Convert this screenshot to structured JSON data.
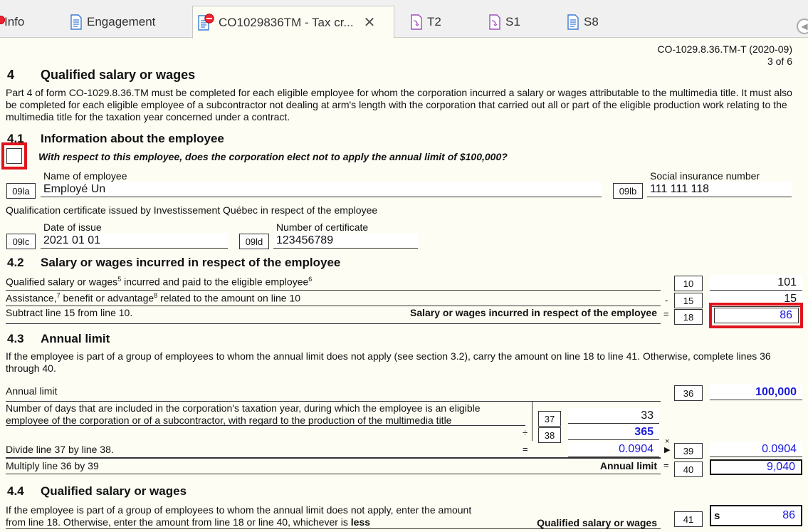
{
  "tabs": [
    {
      "label": "Info"
    },
    {
      "label": "Engagement"
    },
    {
      "label": "CO1029836TM - Tax cr..."
    },
    {
      "label": "T2"
    },
    {
      "label": "S1"
    },
    {
      "label": "S8"
    }
  ],
  "form": {
    "form_id": "CO-1029.8.36.TM-T (2020-09)",
    "page": "3 of 6",
    "section4": {
      "number": "4",
      "title": "Qualified salary or wages",
      "description": "Part 4 of form CO-1029.8.36.TM must be completed for each eligible employee for whom the corporation incurred a salary or wages attributable to the multimedia title. It must also be completed for each eligible employee of a subcontractor not dealing at arm's length with the corporation that carried out all or part of the eligible production work relating to the multimedia title for the taxation year concerned under a contract."
    },
    "s41": {
      "number": "4.1",
      "title": "Information about the employee",
      "election_question": "With respect to this employee, does the corporation elect not to apply the annual limit of $100,000?",
      "name_label": "Name of employee",
      "name_code": "09la",
      "name_value": "Employé Un",
      "sin_label": "Social insurance number",
      "sin_code": "09lb",
      "sin_value": "111 111 118",
      "cert_label": "Qualification certificate issued by Investissement Québec in respect of the employee",
      "date_label": "Date of issue",
      "date_code": "09lc",
      "date_value": "2021 01 01",
      "certnum_label": "Number of certificate",
      "certnum_code": "09ld",
      "certnum_value": "123456789"
    },
    "s42": {
      "number": "4.2",
      "title": "Salary or wages incurred in respect of the employee",
      "line10_a": "Qualified salary or wages",
      "line10_b": " incurred and paid to the eligible employee",
      "line10_sup1": "5",
      "line10_sup2": "6",
      "line10_code": "10",
      "line10_value": "101",
      "line15_a": "Assistance,",
      "line15_b": " benefit or advantage",
      "line15_c": " related to the amount on line 10",
      "line15_sup1": "7",
      "line15_sup2": "8",
      "line15_code": "15",
      "line15_value": "15",
      "line18_label": "Subtract line 15 from line 10.",
      "line18_bold": "Salary or wages incurred in respect of the employee",
      "line18_code": "18",
      "line18_value": "86"
    },
    "s43": {
      "number": "4.3",
      "title": "Annual limit",
      "description": "If the employee is part of a group of employees to whom the annual limit does not apply (see section 3.2), carry the amount on line 18 to line 41. Otherwise, complete lines 36 through 40.",
      "line36_label": "Annual limit",
      "line36_code": "36",
      "line36_value": "100,000",
      "line37_label_1": "Number of days that are included in the corporation's taxation year, during which the employee is an eligible",
      "line37_label_2": "employee of the corporation or of a subcontractor, with regard to the production of the multimedia title",
      "line37_code": "37",
      "line37_value": "33",
      "line38_code": "38",
      "line38_value": "365",
      "line39_label": "Divide line 37 by line 38.",
      "line39_mid_value": "0.0904",
      "line39_code": "39",
      "line39_value": "0.0904",
      "line40_label": "Multiply line 36 by 39",
      "line40_bold": "Annual limit",
      "line40_code": "40",
      "line40_value": "9,040"
    },
    "s44": {
      "number": "4.4",
      "title": "Qualified salary or wages",
      "line41_label_1": "If the employee is part of a group of employees to whom the annual limit does not apply, enter the amount",
      "line41_label_2a": "from line 18. Otherwise, enter the amount from line 18 or line 40, whichever is ",
      "line41_label_2b": "less",
      "line41_bold": "Qualified salary or wages",
      "line41_code": "41",
      "line41_prefix": "s",
      "line41_value": "86"
    },
    "ops": {
      "minus": "-",
      "equals": "=",
      "divide": "÷",
      "times": "×"
    }
  },
  "colors": {
    "accent_red": "#e0141e",
    "value_blue": "#1a1adb"
  }
}
